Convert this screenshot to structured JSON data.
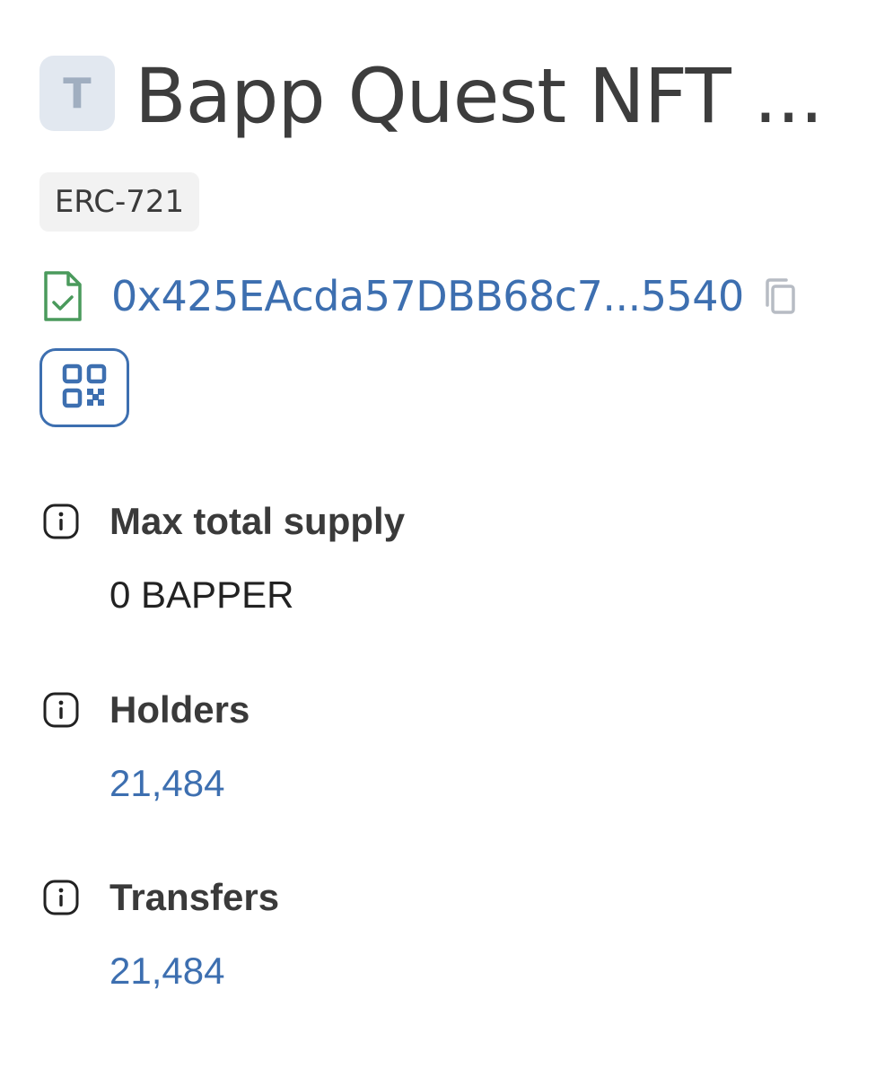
{
  "token": {
    "avatar_letter": "T",
    "title": "Bapp Quest NFT ...",
    "standard_badge": "ERC-721",
    "address": "0x425EAcda57DBB68c7...5540"
  },
  "icons": {
    "contract": "verified-contract-icon",
    "copy": "copy-icon",
    "qr": "qr-code-icon",
    "info": "info-icon"
  },
  "stats": {
    "max_supply": {
      "label": "Max total supply",
      "value": "0 BAPPER"
    },
    "holders": {
      "label": "Holders",
      "value": "21,484"
    },
    "transfers": {
      "label": "Transfers",
      "value": "21,484"
    }
  },
  "colors": {
    "link": "#3d6fb0",
    "verified": "#4a9a5c",
    "avatar_bg": "#e2e8f0",
    "badge_bg": "#f2f2f2"
  }
}
